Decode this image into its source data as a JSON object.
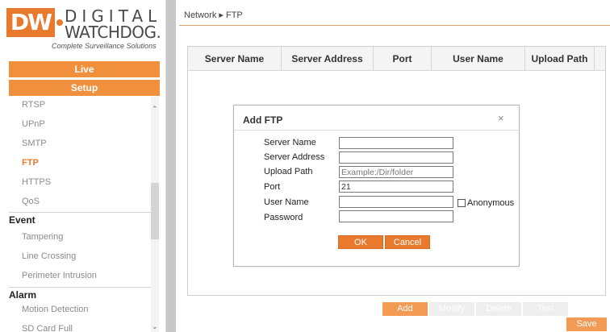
{
  "logo": {
    "mark": "DW",
    "line1": "DIGITAL",
    "line2": "WATCHDOG.",
    "tagline": "Complete Surveillance Solutions"
  },
  "nav": {
    "live": "Live",
    "setup": "Setup"
  },
  "menu": {
    "network_items": [
      "RTSP",
      "UPnP",
      "SMTP",
      "FTP",
      "HTTPS",
      "QoS"
    ],
    "active": "FTP",
    "event_title": "Event",
    "event_items": [
      "Tampering",
      "Line Crossing",
      "Perimeter Intrusion"
    ],
    "alarm_title": "Alarm",
    "alarm_items": [
      "Motion Detection",
      "SD Card Full"
    ]
  },
  "breadcrumb": "Network ▸ FTP",
  "table": {
    "columns": [
      "Server Name",
      "Server Address",
      "Port",
      "User Name",
      "Upload Path"
    ],
    "rows": []
  },
  "dialog": {
    "title": "Add FTP",
    "close": "×",
    "fields": {
      "server_name": {
        "label": "Server Name",
        "value": ""
      },
      "server_address": {
        "label": "Server Address",
        "value": ""
      },
      "upload_path": {
        "label": "Upload Path",
        "value": "",
        "placeholder": "Example:/Dir/folder"
      },
      "port": {
        "label": "Port",
        "value": "21"
      },
      "user_name": {
        "label": "User Name",
        "value": ""
      },
      "password": {
        "label": "Password",
        "value": ""
      }
    },
    "anonymous": {
      "label": "Anonymous",
      "checked": false
    },
    "ok": "OK",
    "cancel": "Cancel"
  },
  "actions": {
    "add": "Add",
    "modify": "Modify",
    "delete": "Delete",
    "test": "Test",
    "save": "Save"
  },
  "colors": {
    "accent": "#e8792d",
    "accent_light": "#f39a55",
    "disabled": "#eeeeee"
  }
}
